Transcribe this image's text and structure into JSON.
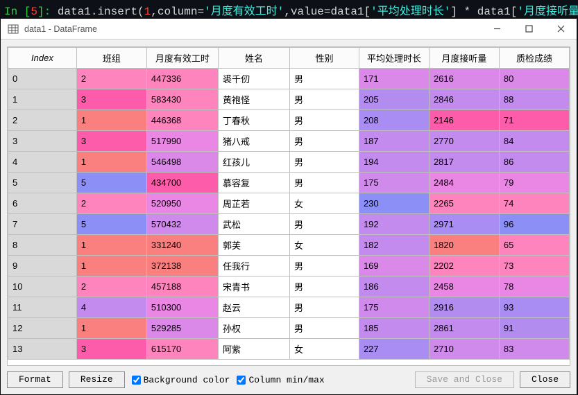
{
  "code": {
    "prompt_prefix": "In [",
    "prompt_num": "5",
    "prompt_suffix": "]: ",
    "seg1": "data1.insert(",
    "arg1": "1",
    "seg2": ",column=",
    "str1": "'月度有效工时'",
    "seg3": ",value=data1[",
    "str2": "'平均处理时长'",
    "seg4": "] * data1[",
    "str3": "'月度接听量'",
    "seg5": "])"
  },
  "window": {
    "title": "data1 - DataFrame"
  },
  "table": {
    "index_header": "Index",
    "columns": [
      "班组",
      "月度有效工时",
      "姓名",
      "性别",
      "平均处理时长",
      "月度接听量",
      "质检成绩"
    ],
    "rows": [
      {
        "idx": "0",
        "cells": [
          "2",
          "447336",
          "裘千仞",
          "男",
          "171",
          "2616",
          "80"
        ],
        "colors": [
          "#fd84bc",
          "#fd84bc",
          "",
          "",
          "#da89e8",
          "#da89e8",
          "#da89e8"
        ]
      },
      {
        "idx": "1",
        "cells": [
          "3",
          "583430",
          "黄袍怪",
          "男",
          "205",
          "2846",
          "88"
        ],
        "colors": [
          "#fc5ca9",
          "#fd84bc",
          "",
          "",
          "#b38cf0",
          "#c38bed",
          "#c38bed"
        ]
      },
      {
        "idx": "2",
        "cells": [
          "1",
          "446368",
          "丁春秋",
          "男",
          "208",
          "2146",
          "71"
        ],
        "colors": [
          "#fa8080",
          "#fd84bc",
          "",
          "",
          "#a98df2",
          "#fc5ca9",
          "#fc5ca9"
        ]
      },
      {
        "idx": "3",
        "cells": [
          "3",
          "517990",
          "猪八戒",
          "男",
          "187",
          "2770",
          "84"
        ],
        "colors": [
          "#fc5ca9",
          "#ea87e5",
          "",
          "",
          "#c38bed",
          "#c38bed",
          "#c38bed"
        ]
      },
      {
        "idx": "4",
        "cells": [
          "1",
          "546498",
          "红孩儿",
          "男",
          "194",
          "2817",
          "86"
        ],
        "colors": [
          "#fa8080",
          "#da89e8",
          "",
          "",
          "#c38bed",
          "#c38bed",
          "#c38bed"
        ]
      },
      {
        "idx": "5",
        "cells": [
          "5",
          "434700",
          "慕容复",
          "男",
          "175",
          "2484",
          "79"
        ],
        "colors": [
          "#8c8ff6",
          "#fc5ca9",
          "",
          "",
          "#d08aeb",
          "#ea87e5",
          "#ea87e5"
        ]
      },
      {
        "idx": "6",
        "cells": [
          "2",
          "520950",
          "周芷若",
          "女",
          "230",
          "2265",
          "74"
        ],
        "colors": [
          "#fd84bc",
          "#ea87e5",
          "",
          "",
          "#8c8ff6",
          "#fd84bc",
          "#fd84bc"
        ]
      },
      {
        "idx": "7",
        "cells": [
          "5",
          "570432",
          "武松",
          "男",
          "192",
          "2971",
          "96"
        ],
        "colors": [
          "#8c8ff6",
          "#d08aeb",
          "",
          "",
          "#c38bed",
          "#a98df2",
          "#8c8ff6"
        ]
      },
      {
        "idx": "8",
        "cells": [
          "1",
          "331240",
          "郭芙",
          "女",
          "182",
          "1820",
          "65"
        ],
        "colors": [
          "#fa8080",
          "#fa8080",
          "",
          "",
          "#c38bed",
          "#fa8080",
          "#fd84bc"
        ]
      },
      {
        "idx": "9",
        "cells": [
          "1",
          "372138",
          "任我行",
          "男",
          "169",
          "2202",
          "73"
        ],
        "colors": [
          "#fa8080",
          "#fa8080",
          "",
          "",
          "#da89e8",
          "#fd84bc",
          "#fd84bc"
        ]
      },
      {
        "idx": "10",
        "cells": [
          "2",
          "457188",
          "宋青书",
          "男",
          "186",
          "2458",
          "78"
        ],
        "colors": [
          "#fd84bc",
          "#fd84bc",
          "",
          "",
          "#c38bed",
          "#ea87e5",
          "#ea87e5"
        ]
      },
      {
        "idx": "11",
        "cells": [
          "4",
          "510300",
          "赵云",
          "男",
          "175",
          "2916",
          "93"
        ],
        "colors": [
          "#c38bed",
          "#ea87e5",
          "",
          "",
          "#d08aeb",
          "#b38cf0",
          "#a98df2"
        ]
      },
      {
        "idx": "12",
        "cells": [
          "1",
          "529285",
          "孙权",
          "男",
          "185",
          "2861",
          "91"
        ],
        "colors": [
          "#fa8080",
          "#da89e8",
          "",
          "",
          "#c38bed",
          "#c38bed",
          "#b38cf0"
        ]
      },
      {
        "idx": "13",
        "cells": [
          "3",
          "615170",
          "阿紫",
          "女",
          "227",
          "2710",
          "83"
        ],
        "colors": [
          "#fc5ca9",
          "#fd84bc",
          "",
          "",
          "#a98df2",
          "#d08aeb",
          "#d08aeb"
        ]
      }
    ]
  },
  "footer": {
    "format": "Format",
    "resize": "Resize",
    "bg_label": "Background color",
    "minmax_label": "Column min/max",
    "save": "Save and Close",
    "close": "Close"
  },
  "chart_data": {
    "type": "table",
    "columns": [
      "Index",
      "班组",
      "月度有效工时",
      "姓名",
      "性别",
      "平均处理时长",
      "月度接听量",
      "质检成绩"
    ],
    "rows": [
      [
        0,
        2,
        447336,
        "裘千仞",
        "男",
        171,
        2616,
        80
      ],
      [
        1,
        3,
        583430,
        "黄袍怪",
        "男",
        205,
        2846,
        88
      ],
      [
        2,
        1,
        446368,
        "丁春秋",
        "男",
        208,
        2146,
        71
      ],
      [
        3,
        3,
        517990,
        "猪八戒",
        "男",
        187,
        2770,
        84
      ],
      [
        4,
        1,
        546498,
        "红孩儿",
        "男",
        194,
        2817,
        86
      ],
      [
        5,
        5,
        434700,
        "慕容复",
        "男",
        175,
        2484,
        79
      ],
      [
        6,
        2,
        520950,
        "周芷若",
        "女",
        230,
        2265,
        74
      ],
      [
        7,
        5,
        570432,
        "武松",
        "男",
        192,
        2971,
        96
      ],
      [
        8,
        1,
        331240,
        "郭芙",
        "女",
        182,
        1820,
        65
      ],
      [
        9,
        1,
        372138,
        "任我行",
        "男",
        169,
        2202,
        73
      ],
      [
        10,
        2,
        457188,
        "宋青书",
        "男",
        186,
        2458,
        78
      ],
      [
        11,
        4,
        510300,
        "赵云",
        "男",
        175,
        2916,
        93
      ],
      [
        12,
        1,
        529285,
        "孙权",
        "男",
        185,
        2861,
        91
      ],
      [
        13,
        3,
        615170,
        "阿紫",
        "女",
        227,
        2710,
        83
      ]
    ]
  }
}
